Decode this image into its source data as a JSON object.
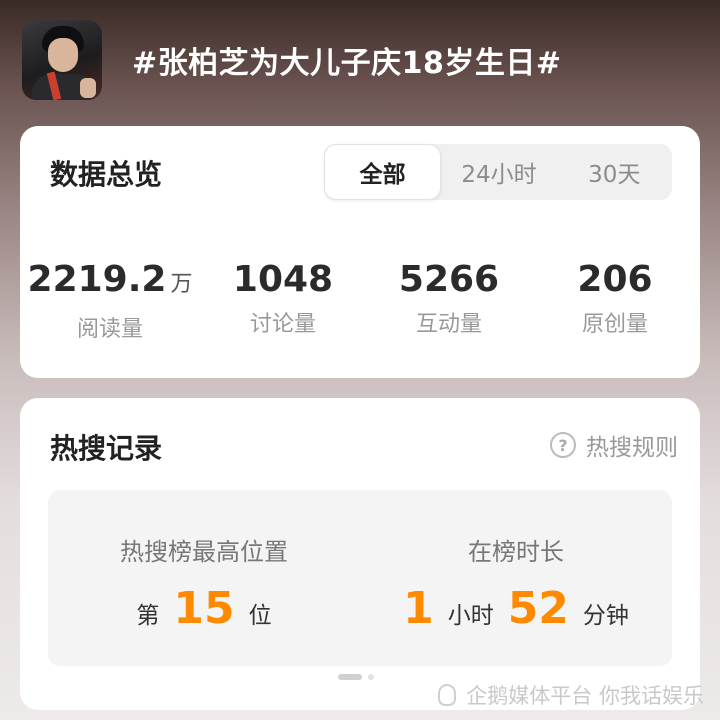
{
  "header": {
    "title": "#张柏芝为大儿子庆18岁生日#",
    "avatar_icon": "user-avatar"
  },
  "overview": {
    "title": "数据总览",
    "tabs": [
      {
        "label": "全部",
        "active": true
      },
      {
        "label": "24小时",
        "active": false
      },
      {
        "label": "30天",
        "active": false
      }
    ],
    "stats": [
      {
        "value": "2219.2",
        "unit": "万",
        "label": "阅读量"
      },
      {
        "value": "1048",
        "unit": "",
        "label": "讨论量"
      },
      {
        "value": "5266",
        "unit": "",
        "label": "互动量"
      },
      {
        "value": "206",
        "unit": "",
        "label": "原创量"
      }
    ]
  },
  "hot": {
    "title": "热搜记录",
    "rules_label": "热搜规则",
    "rules_icon": "question-circle-icon",
    "peak": {
      "label": "热搜榜最高位置",
      "prefix": "第",
      "value": "15",
      "suffix": "位"
    },
    "duration": {
      "label": "在榜时长",
      "hours": "1",
      "hours_unit": "小时",
      "minutes": "52",
      "minutes_unit": "分钟"
    }
  },
  "watermark": {
    "text": "企鹅媒体平台 你我话娱乐"
  },
  "colors": {
    "accent": "#ff8a00",
    "card": "#ffffff",
    "muted": "#999999"
  }
}
